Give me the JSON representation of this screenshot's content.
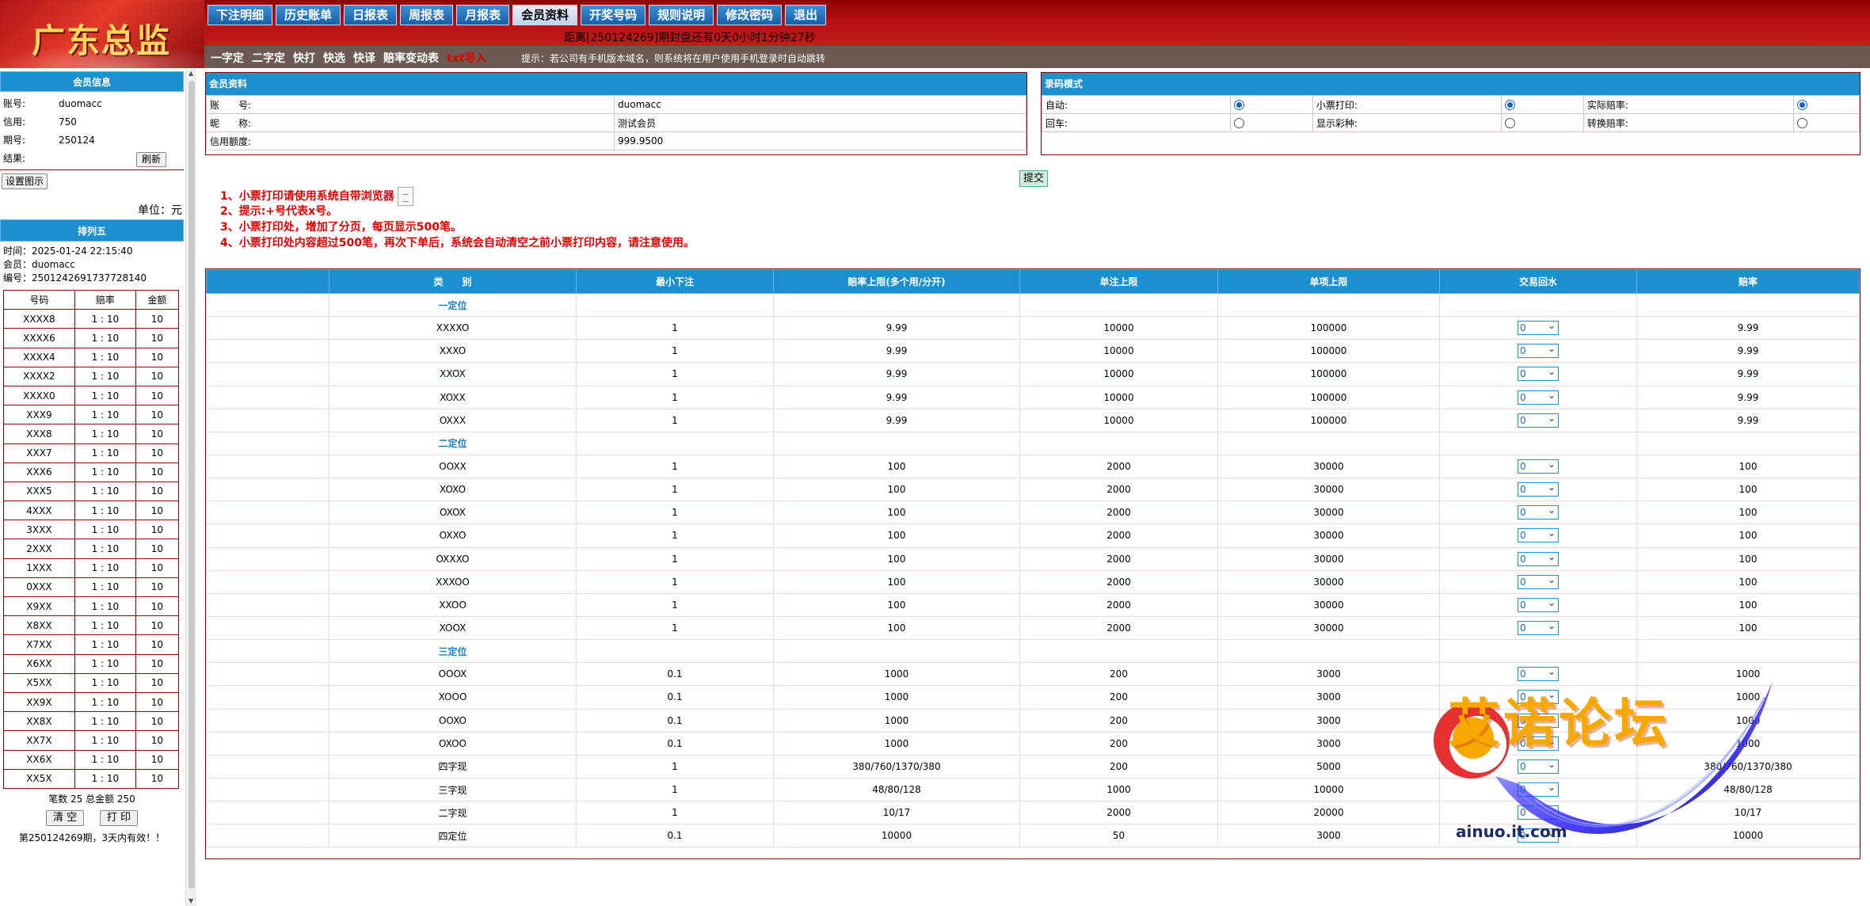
{
  "brand": {
    "logo_text": "广东总监"
  },
  "nav": {
    "items": [
      "下注明细",
      "历史账单",
      "日报表",
      "周报表",
      "月报表",
      "会员资料",
      "开奖号码",
      "规则说明",
      "修改密码",
      "退出"
    ],
    "active_index": 5
  },
  "countdown": "距离[250124269]期封盘还有0天0小时1分钟27秒",
  "subnav": {
    "links": [
      "一字定",
      "二字定",
      "快打",
      "快选",
      "快译",
      "赔率变动表"
    ],
    "red_link": "txt导入",
    "hint": "提示：若公司有手机版本域名，则系统将在用户使用手机登录时自动跳转"
  },
  "member_panel": {
    "title": "会员信息",
    "rows": [
      {
        "label": "账号:",
        "value": "duomacc"
      },
      {
        "label": "信用:",
        "value": "750"
      },
      {
        "label": "期号:",
        "value": "250124"
      },
      {
        "label": "结果:",
        "value": ""
      }
    ],
    "refresh_label": "刷新",
    "demo_label": "设置图示",
    "unit": "单位：元"
  },
  "ticket": {
    "title": "排列五",
    "time": "时间：2025-01-24 22:15:40",
    "member": "会员：duomacc",
    "code": "编号：2501242691737728140",
    "headers": [
      "号码",
      "赔率",
      "金额"
    ],
    "rows": [
      [
        "XXXX8",
        "1 : 10",
        "10"
      ],
      [
        "XXXX6",
        "1 : 10",
        "10"
      ],
      [
        "XXXX4",
        "1 : 10",
        "10"
      ],
      [
        "XXXX2",
        "1 : 10",
        "10"
      ],
      [
        "XXXX0",
        "1 : 10",
        "10"
      ],
      [
        "XXX9",
        "1 : 10",
        "10"
      ],
      [
        "XXX8",
        "1 : 10",
        "10"
      ],
      [
        "XXX7",
        "1 : 10",
        "10"
      ],
      [
        "XXX6",
        "1 : 10",
        "10"
      ],
      [
        "XXX5",
        "1 : 10",
        "10"
      ],
      [
        "4XXX",
        "1 : 10",
        "10"
      ],
      [
        "3XXX",
        "1 : 10",
        "10"
      ],
      [
        "2XXX",
        "1 : 10",
        "10"
      ],
      [
        "1XXX",
        "1 : 10",
        "10"
      ],
      [
        "0XXX",
        "1 : 10",
        "10"
      ],
      [
        "X9XX",
        "1 : 10",
        "10"
      ],
      [
        "X8XX",
        "1 : 10",
        "10"
      ],
      [
        "X7XX",
        "1 : 10",
        "10"
      ],
      [
        "X6XX",
        "1 : 10",
        "10"
      ],
      [
        "X5XX",
        "1 : 10",
        "10"
      ],
      [
        "XX9X",
        "1 : 10",
        "10"
      ],
      [
        "XX8X",
        "1 : 10",
        "10"
      ],
      [
        "XX7X",
        "1 : 10",
        "10"
      ],
      [
        "XX6X",
        "1 : 10",
        "10"
      ],
      [
        "XX5X",
        "1 : 10",
        "10"
      ]
    ],
    "summary": "笔数 25 总金额 250",
    "clear_label": "清 空",
    "print_label": "打 印",
    "note": "第250124269期，3天内有效！！"
  },
  "member_info": {
    "title": "会员资料",
    "rows": [
      {
        "label": "账　　号:",
        "value": "duomacc"
      },
      {
        "label": "昵　　称:",
        "value": "测试会员"
      },
      {
        "label": "信用额度:",
        "value": "999.9500"
      }
    ]
  },
  "record_mode": {
    "title": "录码模式",
    "rows": [
      [
        {
          "label": "自动:",
          "checked": true
        },
        {
          "label": "小票打印:",
          "checked": true
        },
        {
          "label": "实际赔率:",
          "checked": true
        }
      ],
      [
        {
          "label": "回车:",
          "checked": false
        },
        {
          "label": "显示彩种:",
          "checked": false
        },
        {
          "label": "转换赔率:",
          "checked": false
        }
      ]
    ]
  },
  "submit_label": "提交",
  "notes": [
    "1、小票打印请使用系统自带浏览器",
    "2、提示:+号代表x号。",
    "3、小票打印处，增加了分页，每页显示500笔。",
    "4、小票打印处内容超过500笔，再次下单后，系统会自动清空之前小票打印内容，请注意使用。"
  ],
  "odds_table": {
    "headers": [
      "",
      "类　　别",
      "最小下注",
      "赔率上限(多个用/分开)",
      "单注上限",
      "单项上限",
      "交易回水",
      "赔率"
    ],
    "rows": [
      {
        "cat": "一定位"
      },
      {
        "name": "XXXXO",
        "min": "1",
        "max_odds": "9.99",
        "single": "10000",
        "item": "100000",
        "rebate": "0",
        "odds": "9.99"
      },
      {
        "name": "XXXO",
        "min": "1",
        "max_odds": "9.99",
        "single": "10000",
        "item": "100000",
        "rebate": "0",
        "odds": "9.99"
      },
      {
        "name": "XXOX",
        "min": "1",
        "max_odds": "9.99",
        "single": "10000",
        "item": "100000",
        "rebate": "0",
        "odds": "9.99"
      },
      {
        "name": "XOXX",
        "min": "1",
        "max_odds": "9.99",
        "single": "10000",
        "item": "100000",
        "rebate": "0",
        "odds": "9.99"
      },
      {
        "name": "OXXX",
        "min": "1",
        "max_odds": "9.99",
        "single": "10000",
        "item": "100000",
        "rebate": "0",
        "odds": "9.99"
      },
      {
        "cat": "二定位"
      },
      {
        "name": "OOXX",
        "min": "1",
        "max_odds": "100",
        "single": "2000",
        "item": "30000",
        "rebate": "0",
        "odds": "100"
      },
      {
        "name": "XOXO",
        "min": "1",
        "max_odds": "100",
        "single": "2000",
        "item": "30000",
        "rebate": "0",
        "odds": "100"
      },
      {
        "name": "OXOX",
        "min": "1",
        "max_odds": "100",
        "single": "2000",
        "item": "30000",
        "rebate": "0",
        "odds": "100"
      },
      {
        "name": "OXXO",
        "min": "1",
        "max_odds": "100",
        "single": "2000",
        "item": "30000",
        "rebate": "0",
        "odds": "100"
      },
      {
        "name": "OXXXO",
        "min": "1",
        "max_odds": "100",
        "single": "2000",
        "item": "30000",
        "rebate": "0",
        "odds": "100"
      },
      {
        "name": "XXXOO",
        "min": "1",
        "max_odds": "100",
        "single": "2000",
        "item": "30000",
        "rebate": "0",
        "odds": "100"
      },
      {
        "name": "XXOO",
        "min": "1",
        "max_odds": "100",
        "single": "2000",
        "item": "30000",
        "rebate": "0",
        "odds": "100"
      },
      {
        "name": "XOOX",
        "min": "1",
        "max_odds": "100",
        "single": "2000",
        "item": "30000",
        "rebate": "0",
        "odds": "100"
      },
      {
        "cat": "三定位"
      },
      {
        "name": "OOOX",
        "min": "0.1",
        "max_odds": "1000",
        "single": "200",
        "item": "3000",
        "rebate": "0",
        "odds": "1000"
      },
      {
        "name": "XOOO",
        "min": "0.1",
        "max_odds": "1000",
        "single": "200",
        "item": "3000",
        "rebate": "0",
        "odds": "1000"
      },
      {
        "name": "OOXO",
        "min": "0.1",
        "max_odds": "1000",
        "single": "200",
        "item": "3000",
        "rebate": "0",
        "odds": "1000"
      },
      {
        "name": "OXOO",
        "min": "0.1",
        "max_odds": "1000",
        "single": "200",
        "item": "3000",
        "rebate": "0",
        "odds": "1000"
      },
      {
        "name": "四字现",
        "min": "1",
        "max_odds": "380/760/1370/380",
        "single": "200",
        "item": "5000",
        "rebate": "0",
        "odds": "380/760/1370/380"
      },
      {
        "name": "三字现",
        "min": "1",
        "max_odds": "48/80/128",
        "single": "1000",
        "item": "10000",
        "rebate": "0",
        "odds": "48/80/128"
      },
      {
        "name": "二字现",
        "min": "1",
        "max_odds": "10/17",
        "single": "2000",
        "item": "20000",
        "rebate": "0",
        "odds": "10/17"
      },
      {
        "name": "四定位",
        "min": "0.1",
        "max_odds": "10000",
        "single": "50",
        "item": "3000",
        "rebate": "0",
        "odds": "10000"
      }
    ]
  },
  "watermark": {
    "text": "艾诺论坛",
    "url": "ainuo.it.com"
  }
}
